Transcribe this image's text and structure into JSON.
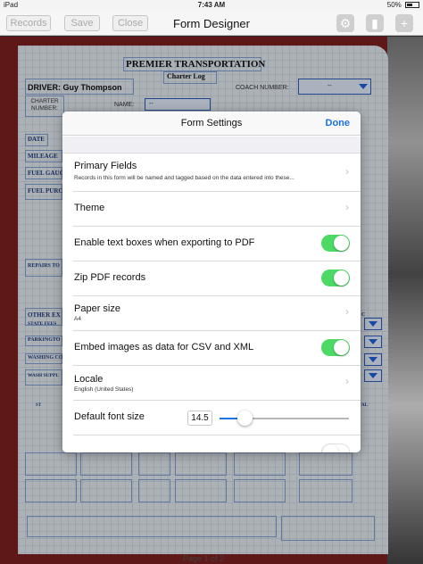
{
  "status_bar": {
    "device": "iPad",
    "time": "7:43 AM",
    "battery": "50%"
  },
  "nav": {
    "records_label": "Records",
    "save_label": "Save",
    "close_label": "Close",
    "title": "Form Designer",
    "icons": [
      "settings-icon",
      "document-icon",
      "add-icon"
    ]
  },
  "form": {
    "company": "PREMIER TRANSPORTATION",
    "subtitle": "Charter Log",
    "driver_label": "DRIVER:  Guy Thompson",
    "coach_number_label": "COACH NUMBER:",
    "coach_value": "--",
    "charter_label": "CHARTER NUMBER:",
    "name_label": "NAME:",
    "name_value": "--",
    "date_label": "DATE",
    "mileage_label": "MILEAGE",
    "fuel_gauge_label": "FUEL GAUG",
    "fuel_purch_label": "FUEL PURCH",
    "repairs_label": "REPAIRS TO",
    "other_label": "OTHER EX",
    "state_fees_label": "STATE FEES",
    "parking_label": "PARKINGTO",
    "washing_label": "WASHING CO",
    "wash_supply_label": "WASH SUPPL",
    "st_label": "ST",
    "total_label": "TAL",
    "c_label": "C",
    "page_indicator": "Page 1 of 2"
  },
  "modal": {
    "title": "Form Settings",
    "done_label": "Done",
    "rows": [
      {
        "label": "Primary Fields",
        "sub": "Records in this form will be named and tagged based on the data entered into these..."
      },
      {
        "label": "Theme"
      },
      {
        "label": "Enable text boxes when exporting to PDF",
        "toggle": true
      },
      {
        "label": "Zip PDF records",
        "toggle": true
      },
      {
        "label": "Paper size",
        "sub": "A4"
      },
      {
        "label": "Embed images as data for CSV and XML",
        "toggle": true
      },
      {
        "label": "Locale",
        "sub": "English (United States)"
      },
      {
        "label": "Default font size",
        "value": "14.5"
      }
    ],
    "accent_color": "#1a73e8",
    "toggle_on_color": "#4cd964"
  }
}
